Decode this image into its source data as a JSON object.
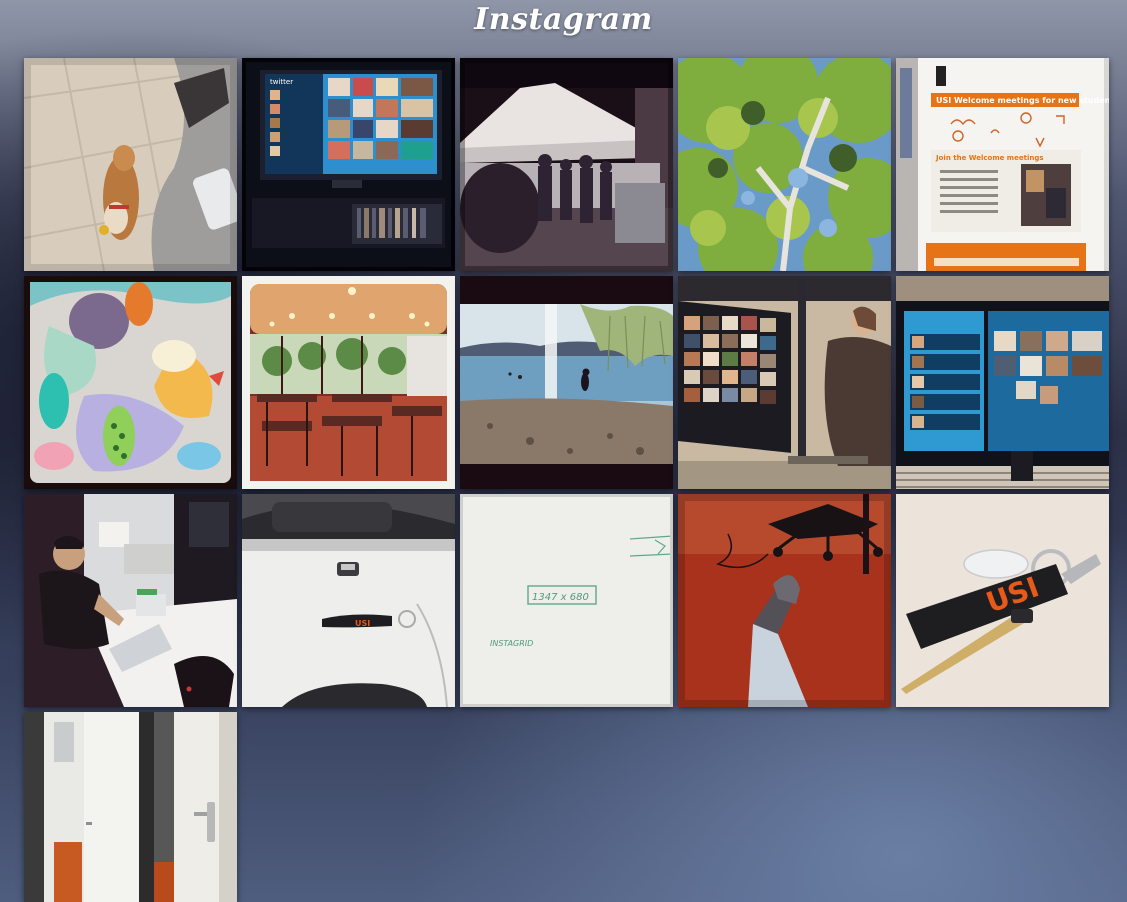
{
  "header": {
    "logo_text": "Instagram"
  },
  "photos": [
    {
      "subject": "dog-on-tiled-floor"
    },
    {
      "subject": "twitter-wall-on-tv"
    },
    {
      "subject": "people-under-white-tent"
    },
    {
      "subject": "tree-canopy-blue-sky"
    },
    {
      "subject": "usi-welcome-meetings-poster"
    },
    {
      "subject": "abstract-colorful-painting"
    },
    {
      "subject": "cafeteria-hall"
    },
    {
      "subject": "child-on-lake-beach"
    },
    {
      "subject": "woman-at-photo-wall-monitor"
    },
    {
      "subject": "twitter-instagram-dashboard-monitor"
    },
    {
      "subject": "man-at-desk-with-laptops"
    },
    {
      "subject": "desk-with-keys-and-bag"
    },
    {
      "subject": "whiteboard-with-sketch"
    },
    {
      "subject": "foot-on-red-floor"
    },
    {
      "subject": "usi-lanyard-with-keys"
    },
    {
      "subject": "open-office-door"
    }
  ],
  "poster": {
    "headline": "USI Welcome meetings for new students",
    "subtitle": "Join the Welcome meetings"
  },
  "lanyard": {
    "text": "USI"
  },
  "whiteboard": {
    "label_main": "1347 x 680",
    "label_small": "INSTAGRID"
  },
  "twitter_screen": {
    "label": "twitter"
  },
  "colors": {
    "accent_orange": "#e67315",
    "lanyard_text": "#e85a1a",
    "floor_red": "#a8321c"
  }
}
